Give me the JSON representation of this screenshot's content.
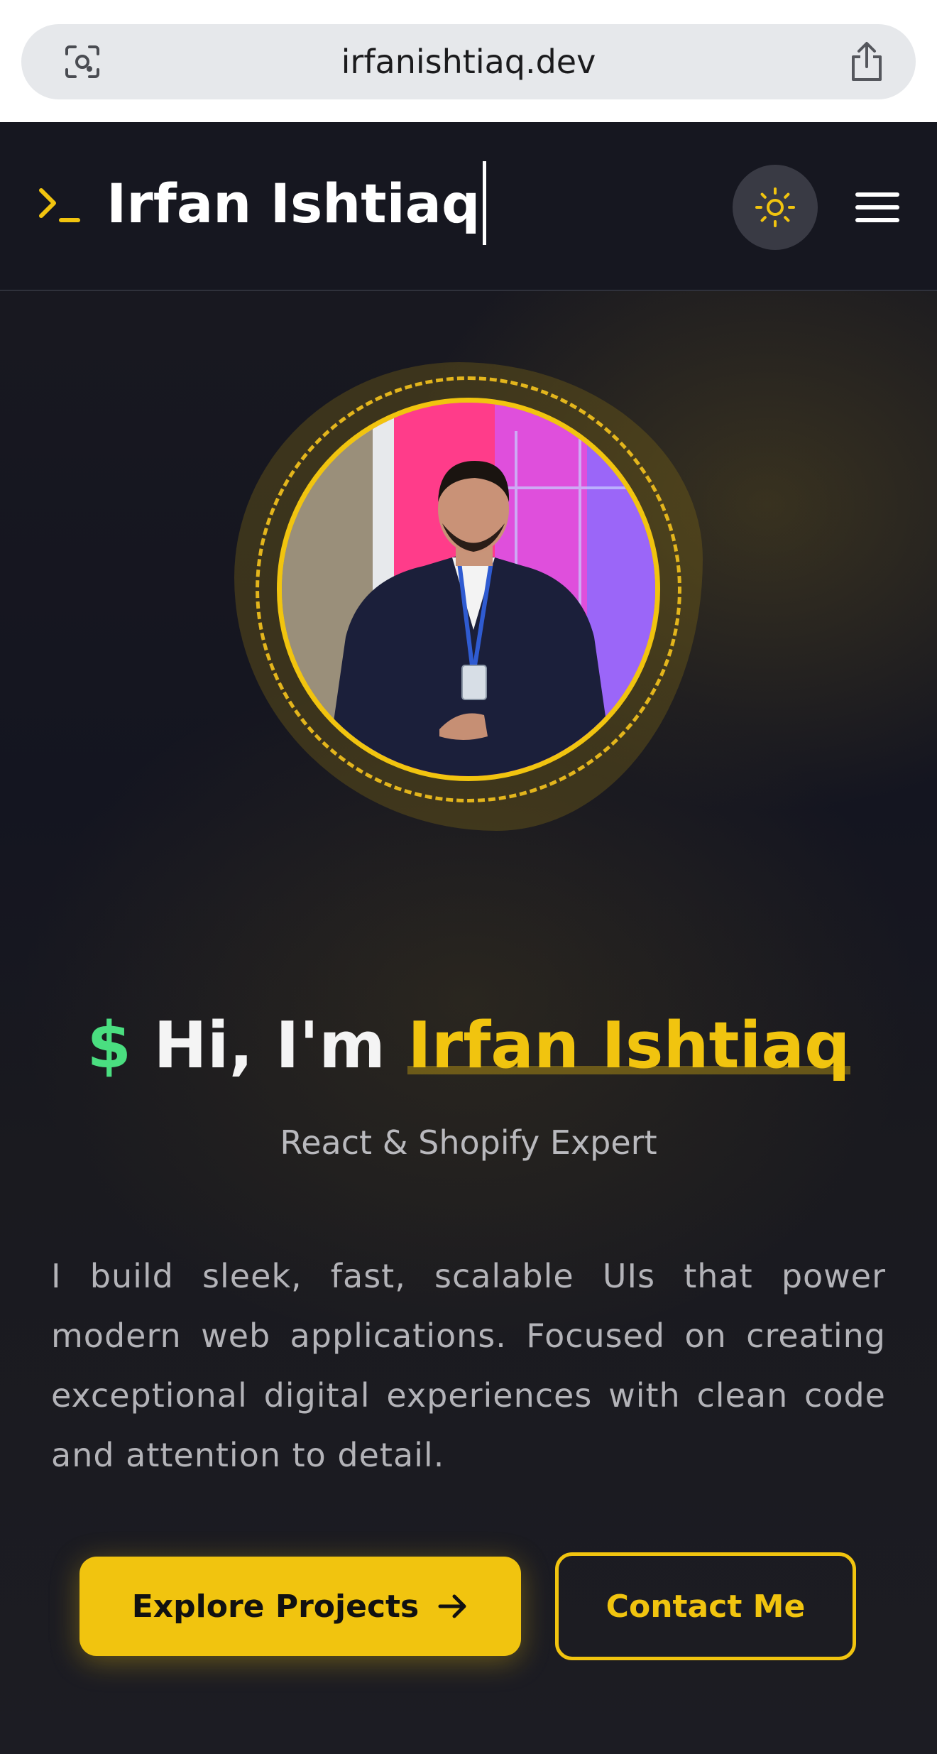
{
  "browser": {
    "url": "irfanishtiaq.dev",
    "lens_icon": "camera-lens-icon",
    "share_icon": "share-icon"
  },
  "header": {
    "brand": "Irfan Ishtiaq",
    "logo_icon": "terminal-prompt-icon",
    "theme_toggle_icon": "sun-icon",
    "menu_icon": "hamburger-menu-icon"
  },
  "hero": {
    "avatar_alt": "profile-photo",
    "headline_prefix": "$",
    "headline_greeting": "Hi, I'm",
    "headline_name": "Irfan Ishtiaq",
    "subtitle": "React & Shopify Expert",
    "bio": "I build sleek, fast, scalable UIs that power modern web applications. Focused on creating exceptional digital experiences with clean code and attention to detail.",
    "primary_button": "Explore Projects",
    "primary_button_icon": "arrow-right-icon",
    "secondary_button": "Contact Me"
  },
  "colors": {
    "accent": "#f1c40f",
    "prompt_green": "#4ade80",
    "header_bg": "#161720",
    "hero_bg": "#141520"
  }
}
